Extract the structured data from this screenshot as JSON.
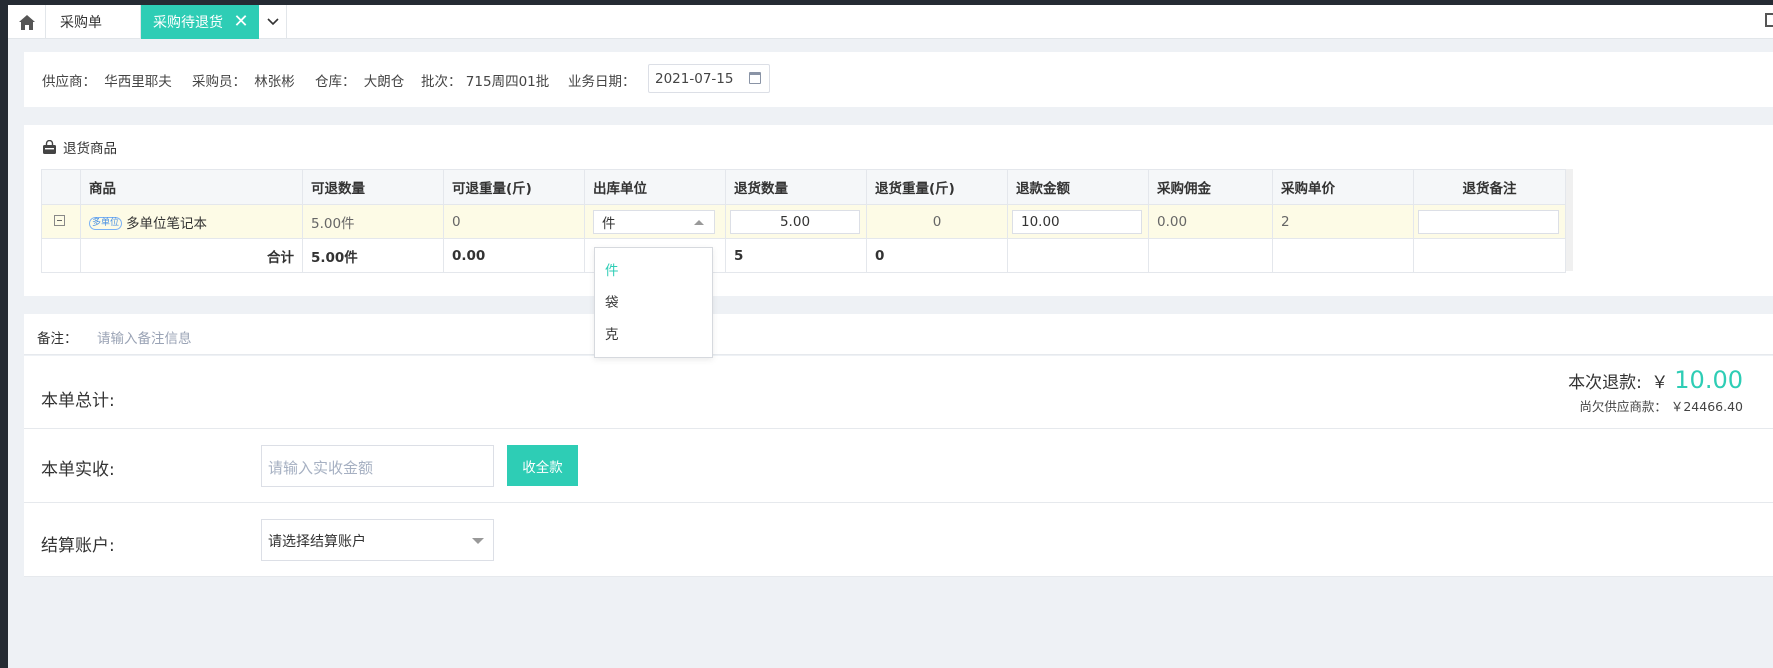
{
  "tabs": {
    "home_icon": "home-icon",
    "items": [
      {
        "label": "采购单"
      },
      {
        "label": "采购待退货"
      }
    ],
    "close_glyph": "✕"
  },
  "info": {
    "supplier_label": "供应商：",
    "supplier": "华西里耶夫",
    "buyer_label": "采购员：",
    "buyer": "林张彬",
    "warehouse_label": "仓库：",
    "warehouse": "大朗仓",
    "batch_label": "批次：",
    "batch": "715周四01批",
    "date_label": "业务日期：",
    "date": "2021-07-15"
  },
  "goods": {
    "section_title": "退货商品",
    "columns": [
      "商品",
      "可退数量",
      "可退重量(斤)",
      "出库单位",
      "退货数量",
      "退货重量(斤)",
      "退款金额",
      "采购佣金",
      "采购单价",
      "退货备注"
    ],
    "row": {
      "tag": "多单位",
      "name": "多单位笔记本",
      "returnable_qty": "5.00件",
      "returnable_weight": "0",
      "unit": "件",
      "return_qty": "5.00",
      "return_weight": "0",
      "refund_amount": "10.00",
      "commission": "0.00",
      "unit_price": "2",
      "remark": ""
    },
    "total": {
      "label": "合计",
      "returnable_qty": "5.00件",
      "returnable_weight": "0.00",
      "return_qty": "5",
      "return_weight": "0"
    }
  },
  "unit_dropdown": {
    "options": [
      "件",
      "袋",
      "克"
    ],
    "selected": "件"
  },
  "remark": {
    "label": "备注：",
    "placeholder": "请输入备注信息"
  },
  "summary": {
    "total_label": "本单总计:",
    "refund_label": "本次退款:",
    "refund_currency": "￥",
    "refund_value": "10.00",
    "owe_label": "尚欠供应商款：",
    "owe_value": "￥24466.40",
    "received_label": "本单实收:",
    "received_placeholder": "请输入实收金额",
    "collect_all_button": "收全款",
    "account_label": "结算账户:",
    "account_placeholder": "请选择结算账户"
  },
  "colors": {
    "accent": "#2ecdb5",
    "row_highlight": "#fdfbe6"
  }
}
